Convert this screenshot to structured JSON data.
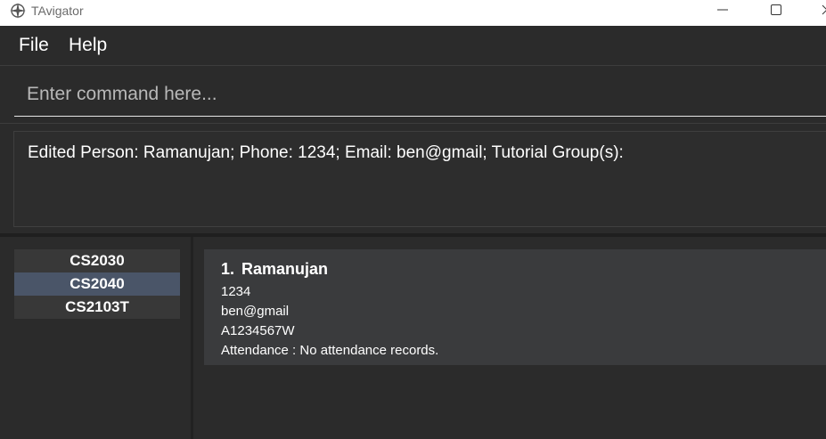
{
  "window": {
    "title": "TAvigator",
    "icon": "compass-icon"
  },
  "menu": {
    "items": [
      "File",
      "Help"
    ]
  },
  "command": {
    "placeholder": "Enter command here...",
    "value": ""
  },
  "result": {
    "text": "Edited Person: Ramanujan; Phone: 1234; Email: ben@gmail; Tutorial Group(s):"
  },
  "groups": {
    "items": [
      "CS2030",
      "CS2040",
      "CS2103T"
    ],
    "selected": "CS2040"
  },
  "persons": [
    {
      "index": "1.",
      "name": "Ramanujan",
      "phone": "1234",
      "email": "ben@gmail",
      "student_id": "A1234567W",
      "attendance": "Attendance : No attendance records."
    }
  ],
  "colors": {
    "background": "#2b2b2b",
    "selected_group": "#4a5568",
    "card": "#3a3b3d"
  }
}
